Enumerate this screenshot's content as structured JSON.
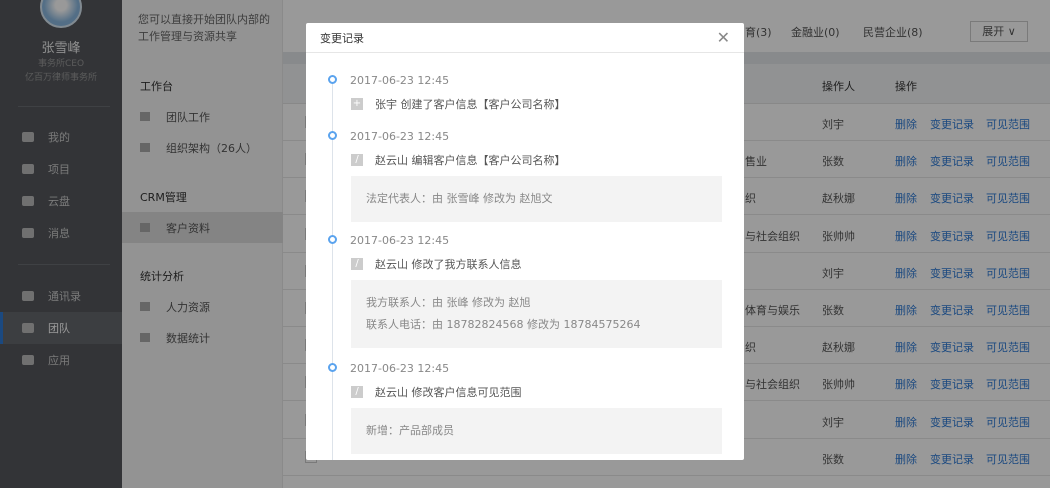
{
  "user": {
    "name": "张雪峰",
    "title": "事务所CEO",
    "company": "亿百万律师事务所"
  },
  "nav": [
    {
      "label": "我的",
      "icon": "user-icon"
    },
    {
      "label": "项目",
      "icon": "project-icon"
    },
    {
      "label": "云盘",
      "icon": "cloud-icon"
    },
    {
      "label": "消息",
      "icon": "message-icon"
    },
    {
      "label": "通讯录",
      "icon": "contacts-icon"
    },
    {
      "label": "团队",
      "icon": "flag-icon"
    },
    {
      "label": "应用",
      "icon": "grid-icon"
    }
  ],
  "panel": {
    "intro": "您可以直接开始团队内部的工作管理与资源共享",
    "sections": [
      {
        "title": "工作台",
        "items": [
          "团队工作",
          "组织架构（26人）"
        ]
      },
      {
        "title": "CRM管理",
        "items": [
          "客户资料"
        ]
      },
      {
        "title": "统计分析",
        "items": [
          "人力资源",
          "数据统计"
        ]
      }
    ]
  },
  "filters": {
    "tabs": [
      "育(3)",
      "金融业(0)",
      "民营企业(8)"
    ],
    "expand": "展开"
  },
  "table": {
    "headers": {
      "operator": "操作人",
      "actions": "操作"
    },
    "actions": {
      "delete": "删除",
      "history": "变更记录",
      "visibility": "可见范围"
    },
    "rows": [
      {
        "industry": "",
        "operator": "刘宇"
      },
      {
        "industry": "售业",
        "operator": "张数"
      },
      {
        "industry": "织",
        "operator": "赵秋娜"
      },
      {
        "industry": "与社会组织",
        "operator": "张帅帅"
      },
      {
        "industry": "",
        "operator": "刘宇"
      },
      {
        "industry": "体育与娱乐",
        "operator": "张数"
      },
      {
        "industry": "织",
        "operator": "赵秋娜"
      },
      {
        "industry": "与社会组织",
        "operator": "张帅帅"
      },
      {
        "industry": "",
        "operator": "刘宇"
      },
      {
        "industry": "",
        "operator": "张数"
      }
    ]
  },
  "modal": {
    "title": "变更记录",
    "entries": [
      {
        "time": "2017-06-23 12:45",
        "icon": "plus-icon",
        "action": "张宇 创建了客户信息【客户公司名称】",
        "details": []
      },
      {
        "time": "2017-06-23 12:45",
        "icon": "edit-icon",
        "action": "赵云山 编辑客户信息【客户公司名称】",
        "details": [
          "法定代表人：由 张雪峰 修改为 赵旭文"
        ]
      },
      {
        "time": "2017-06-23 12:45",
        "icon": "edit-icon",
        "action": "赵云山 修改了我方联系人信息",
        "details": [
          "我方联系人：由 张峰 修改为 赵旭",
          "联系人电话：由 18782824568 修改为 18784575264"
        ]
      },
      {
        "time": "2017-06-23 12:45",
        "icon": "edit-icon",
        "action": "赵云山 修改客户信息可见范围",
        "details": [
          "新增：产品部成员"
        ]
      }
    ]
  },
  "colors": {
    "accent": "#2d7ad6",
    "timeline": "#5aa3ee"
  }
}
